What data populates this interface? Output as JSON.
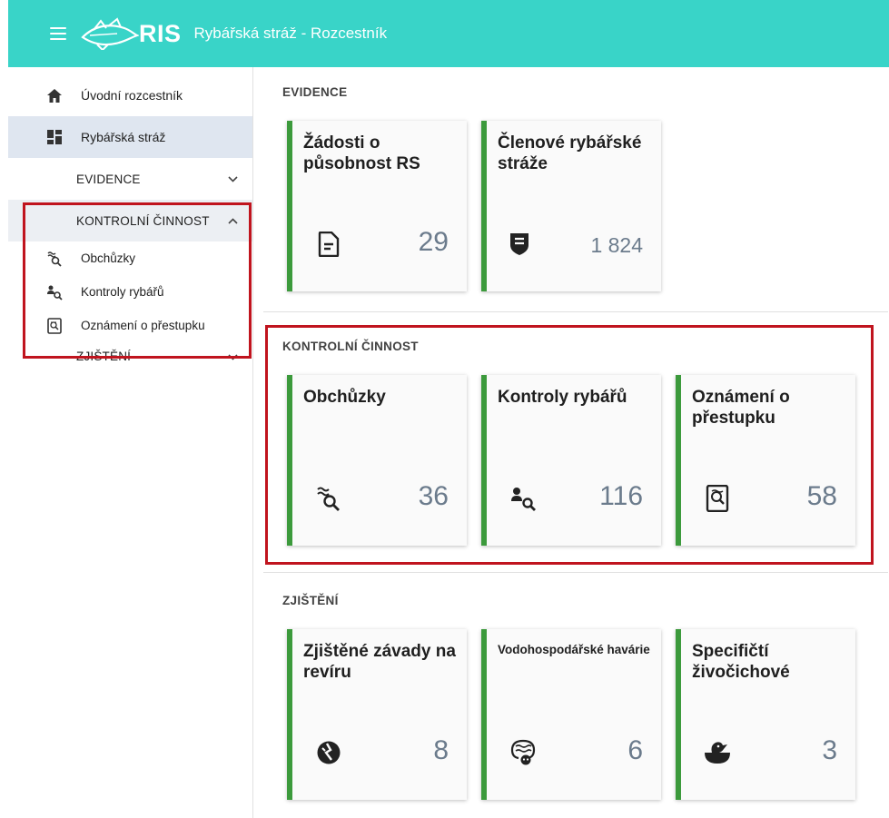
{
  "app": {
    "logo_text": "RIS",
    "title": "Rybářská stráž - Rozcestník"
  },
  "sidebar": {
    "items": [
      {
        "label": "Úvodní rozcestník",
        "icon": "home-icon"
      },
      {
        "label": "Rybářská stráž",
        "icon": "dashboard-icon"
      }
    ],
    "groups": {
      "evidence": "EVIDENCE",
      "kontrolni": "KONTROLNÍ ČINNOST",
      "zjisteni": "ZJIŠTĚNÍ"
    },
    "sub_items": [
      {
        "label": "Obchůzky",
        "icon": "patrol-search-icon"
      },
      {
        "label": "Kontroly rybářů",
        "icon": "person-search-icon"
      },
      {
        "label": "Oznámení o přestupku",
        "icon": "violation-report-icon"
      }
    ]
  },
  "sections": {
    "evidence": {
      "title": "EVIDENCE",
      "cards": [
        {
          "title": "Žádosti o působnost RS",
          "count": "29",
          "icon": "document-icon"
        },
        {
          "title": "Členové rybářské stráže",
          "count": "1 824",
          "icon": "shield-icon"
        }
      ]
    },
    "kontrolni": {
      "title": "KONTROLNÍ ČINNOST",
      "cards": [
        {
          "title": "Obchůzky",
          "count": "36",
          "icon": "patrol-search-icon"
        },
        {
          "title": "Kontroly rybářů",
          "count": "116",
          "icon": "person-search-icon"
        },
        {
          "title": "Oznámení o přestupku",
          "count": "58",
          "icon": "violation-report-icon"
        }
      ]
    },
    "zjisteni": {
      "title": "ZJIŠTĚNÍ",
      "cards": [
        {
          "title": "Zjištěné závady na revíru",
          "count": "8",
          "icon": "broken-globe-icon"
        },
        {
          "title": "Vodohospodářské havárie",
          "count": "6",
          "icon": "pollution-icon"
        },
        {
          "title": "Specifičtí živočichové",
          "count": "3",
          "icon": "duck-icon"
        }
      ]
    }
  },
  "colors": {
    "topbar": "#39d4c8",
    "card_accent": "#3c9a3c",
    "highlight": "#c0141e",
    "count": "#6b7b8c"
  }
}
